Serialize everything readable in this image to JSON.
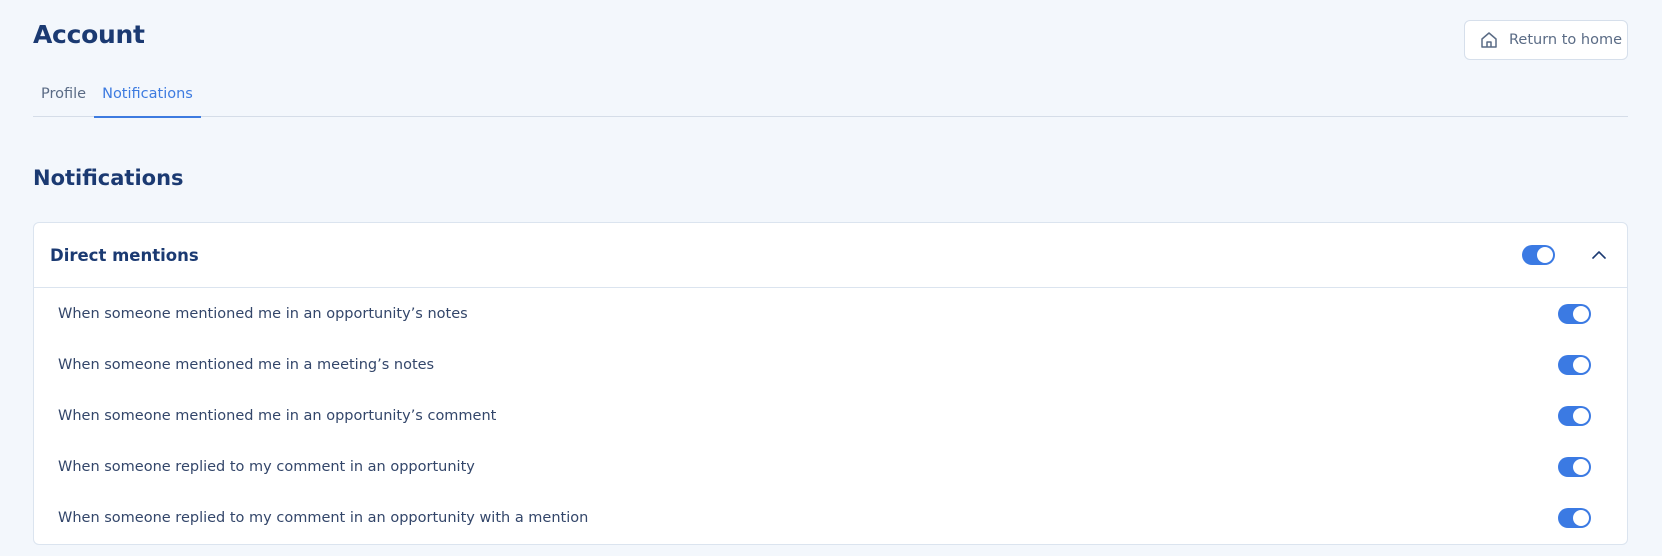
{
  "header": {
    "title": "Account",
    "return_home_label": "Return to home",
    "home_icon": "home-icon"
  },
  "tabs": [
    {
      "label": "Profile",
      "active": false
    },
    {
      "label": "Notifications",
      "active": true
    }
  ],
  "section": {
    "title": "Notifications"
  },
  "card": {
    "title": "Direct mentions",
    "master_toggle_on": true,
    "expanded": true,
    "items": [
      {
        "label": "When someone mentioned me in an opportunity’s notes",
        "on": true
      },
      {
        "label": "When someone mentioned me in a meeting’s notes",
        "on": true
      },
      {
        "label": "When someone mentioned me in an opportunity’s comment",
        "on": true
      },
      {
        "label": "When someone replied to my comment in an opportunity",
        "on": true
      },
      {
        "label": "When someone replied to my comment in an opportunity with a mention",
        "on": true
      }
    ]
  },
  "colors": {
    "accent": "#3b7ae3",
    "heading": "#1b3a72",
    "background": "#f3f7fc"
  }
}
